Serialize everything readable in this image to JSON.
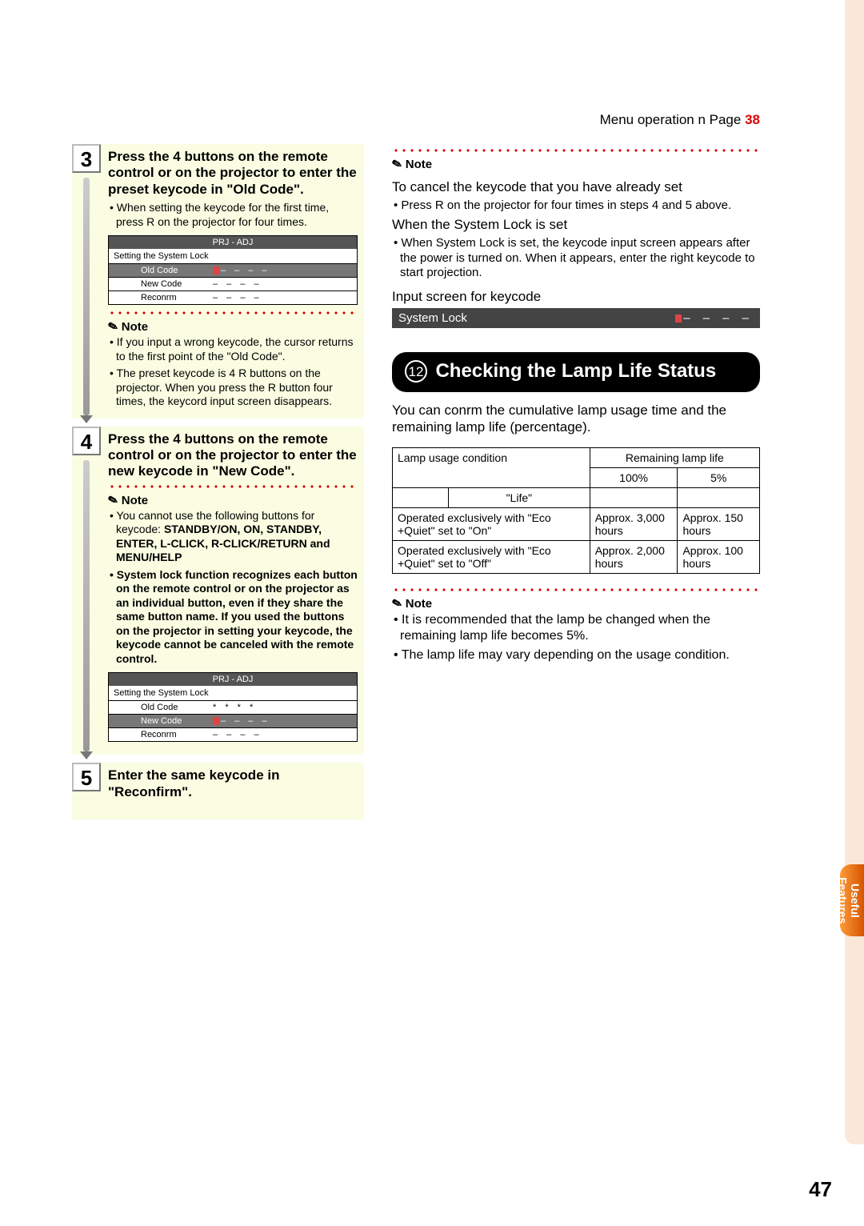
{
  "menuOperation": {
    "text": "Menu operation n Page",
    "page": "38"
  },
  "step3": {
    "num": "3",
    "title": "Press the 4 buttons on the remote control or on the projector to enter the preset keycode in \"Old Code\".",
    "sub": "When setting the keycode for the first time, press R on the projector for four times.",
    "box": {
      "head": "PRJ - ADJ",
      "head2": "Setting the System Lock",
      "rows": [
        {
          "label": "Old Code",
          "val": "– – – –",
          "hl": true,
          "cursor": true
        },
        {
          "label": "New Code",
          "val": "– – – –",
          "hl": false
        },
        {
          "label": "Reconrm",
          "val": "– – – –",
          "hl": false
        }
      ]
    },
    "noteHead": "Note",
    "note1": "If you input a wrong keycode, the cursor returns to the first point of the \"Old Code\".",
    "note2": "The preset keycode is 4 R buttons on the projector. When you press the R button four times, the keycord input screen disappears."
  },
  "step4": {
    "num": "4",
    "title": "Press the 4 buttons on the remote control or on the projector to enter the new keycode in \"New Code\".",
    "noteHead": "Note",
    "note1a": "You cannot use the following buttons for keycode:",
    "note1b": "STANDBY/ON, ON, STANDBY, ENTER, L-CLICK, R-CLICK/RETURN and MENU/HELP",
    "note2": "System lock function recognizes each button on the remote control or on the projector as an individual button, even if they share the same button name. If you used the buttons on the projector in setting your keycode, the keycode cannot be canceled with the remote control.",
    "box": {
      "head": "PRJ - ADJ",
      "head2": "Setting the System Lock",
      "rows": [
        {
          "label": "Old Code",
          "val": "* * * *",
          "hl": false
        },
        {
          "label": "New Code",
          "val": "– – – –",
          "hl": true,
          "cursor": true
        },
        {
          "label": "Reconrm",
          "val": "– – – –",
          "hl": false
        }
      ]
    }
  },
  "step5": {
    "num": "5",
    "title": "Enter the same keycode in \"Reconfirm\"."
  },
  "topRightNote": {
    "head": "Note",
    "line1": "To cancel the keycode that you have already set",
    "line2": "Press R on the projector for four times in steps 4 and 5 above.",
    "line3": "When the System Lock is set",
    "line4": "When System Lock is set, the keycode input screen appears after the power is turned on. When it appears, enter the right keycode to start projection.",
    "inputLabel": "Input screen for keycode",
    "sysLockLabel": "System Lock",
    "sysLockDashes": "– – – –"
  },
  "section12": {
    "num": "12",
    "title": "Checking the Lamp Life Status",
    "body": "You can conrm the cumulative lamp usage time and the remaining lamp life (percentage).",
    "table": {
      "h1": "Lamp usage condition",
      "h2": "Remaining lamp life",
      "lifeLabel": "\"Life\"",
      "c100": "100%",
      "c5": "5%",
      "r1a": "Operated exclusively with \"Eco +Quiet\" set to \"On\"",
      "r1b": "Approx. 3,000 hours",
      "r1c": "Approx. 150 hours",
      "r2a": "Operated exclusively with \"Eco +Quiet\" set to \"Off\"",
      "r2b": "Approx. 2,000 hours",
      "r2c": "Approx. 100 hours"
    },
    "noteHead": "Note",
    "note1": "It is recommended that the lamp be changed when the remaining lamp life becomes 5%.",
    "note2": "The lamp life may vary depending on the usage condition."
  },
  "sideTab": "Useful Features",
  "pageNum": "47"
}
